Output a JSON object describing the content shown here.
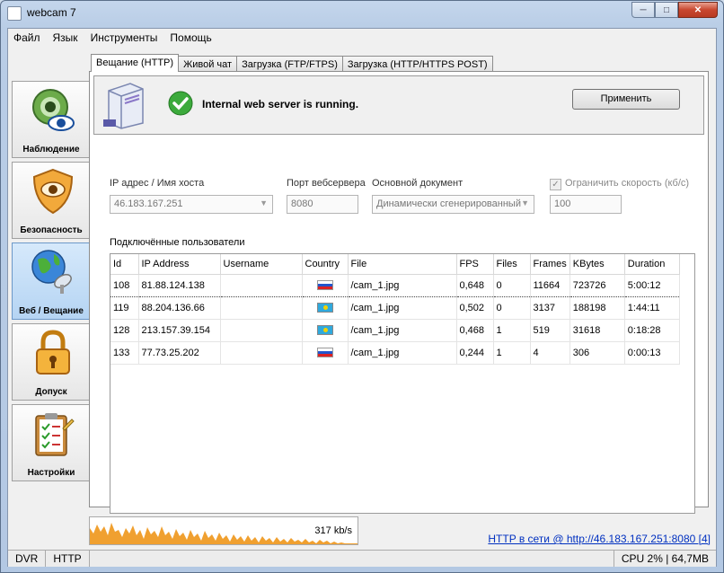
{
  "window": {
    "title": "webcam 7"
  },
  "menu": [
    "Файл",
    "Язык",
    "Инструменты",
    "Помощь"
  ],
  "sidebar": [
    {
      "label": "Наблюдение",
      "icon": "eye-camera-icon",
      "active": false
    },
    {
      "label": "Безопасность",
      "icon": "shield-eye-icon",
      "active": false
    },
    {
      "label": "Веб / Вещание",
      "icon": "globe-satellite-icon",
      "active": true
    },
    {
      "label": "Допуск",
      "icon": "padlock-icon",
      "active": false
    },
    {
      "label": "Настройки",
      "icon": "clipboard-checklist-icon",
      "active": false
    }
  ],
  "tabs": [
    "Вещание (HTTP)",
    "Живой чат",
    "Загрузка (FTP/FTPS)",
    "Загрузка (HTTP/HTTPS POST)"
  ],
  "status": {
    "message": "Internal web server is running.",
    "apply_label": "Применить"
  },
  "fields": {
    "ip_label": "IP адрес / Имя хоста",
    "ip_value": "46.183.167.251",
    "port_label": "Порт вебсервера",
    "port_value": "8080",
    "doc_label": "Основной документ",
    "doc_value": "Динамически сгенерированный",
    "limit_label": "Ограничить скорость (кб/с)",
    "limit_value": "100"
  },
  "users": {
    "label": "Подключённые пользователи",
    "columns": [
      "Id",
      "IP Address",
      "Username",
      "Country",
      "File",
      "FPS",
      "Files",
      "Frames",
      "KBytes",
      "Duration"
    ],
    "rows": [
      {
        "id": "108",
        "ip": "81.88.124.138",
        "username": "",
        "country": "ru",
        "file": "/cam_1.jpg",
        "fps": "0,648",
        "files": "0",
        "frames": "11664",
        "kbytes": "723726",
        "duration": "5:00:12"
      },
      {
        "id": "119",
        "ip": "88.204.136.66",
        "username": "",
        "country": "kz",
        "file": "/cam_1.jpg",
        "fps": "0,502",
        "files": "0",
        "frames": "3137",
        "kbytes": "188198",
        "duration": "1:44:11"
      },
      {
        "id": "128",
        "ip": "213.157.39.154",
        "username": "",
        "country": "kz",
        "file": "/cam_1.jpg",
        "fps": "0,468",
        "files": "1",
        "frames": "519",
        "kbytes": "31618",
        "duration": "0:18:28"
      },
      {
        "id": "133",
        "ip": "77.73.25.202",
        "username": "",
        "country": "ru",
        "file": "/cam_1.jpg",
        "fps": "0,244",
        "files": "1",
        "frames": "4",
        "kbytes": "306",
        "duration": "0:00:13"
      }
    ]
  },
  "traffic": {
    "label": "317 kb/s"
  },
  "http_link": "HTTP в сети @ http://46.183.167.251:8080 [4]",
  "statusbar": {
    "dvr": "DVR",
    "http": "HTTP",
    "cpu": "CPU 2% | 64,7MB"
  },
  "colors": {
    "accent": "#b5d4f3",
    "traffic": "#f0a030",
    "link": "#0030c0"
  }
}
